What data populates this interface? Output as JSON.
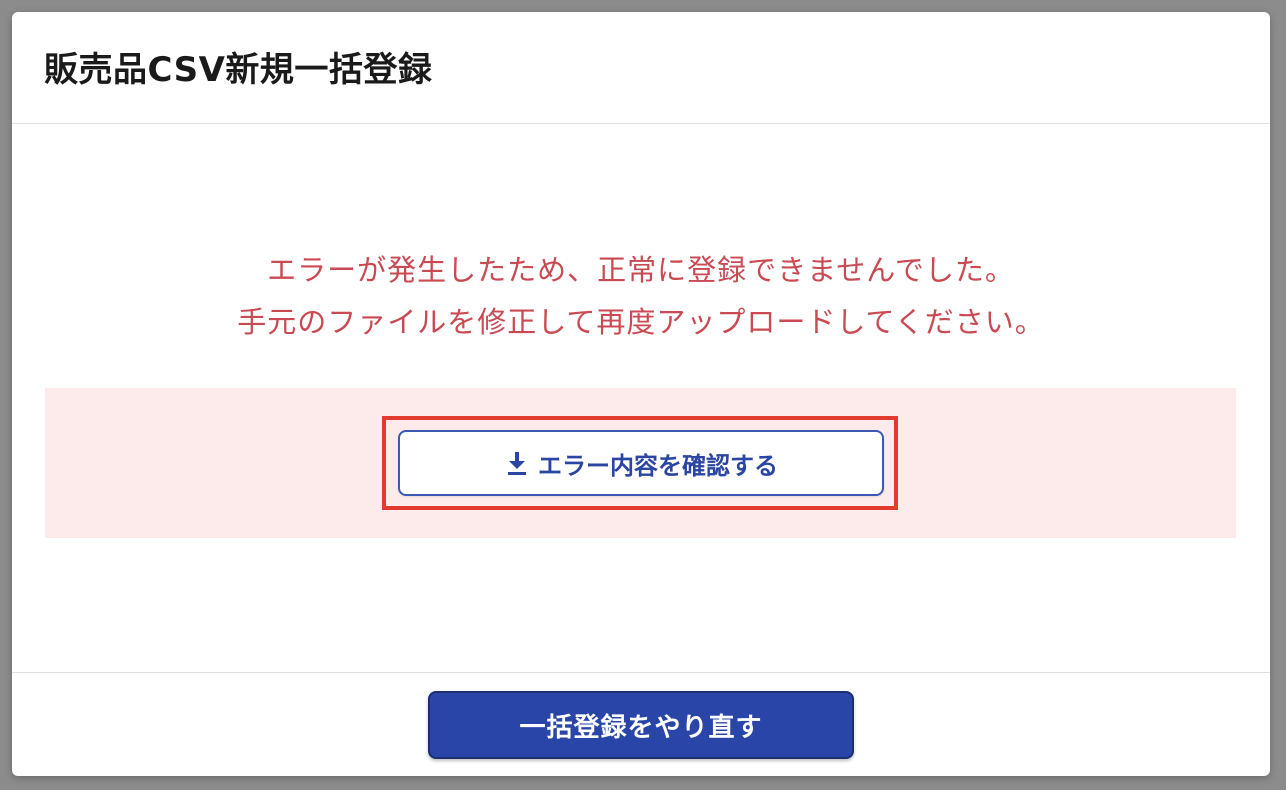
{
  "dialog": {
    "title": "販売品CSV新規一括登録"
  },
  "error": {
    "line1": "エラーが発生したため、正常に登録できませんでした。",
    "line2": "手元のファイルを修正して再度アップロードしてください。",
    "text_color": "#c94a52",
    "band_color": "#fcebea"
  },
  "error_detail_button": {
    "label": "エラー内容を確認する",
    "icon": "download-icon",
    "highlight_color": "#e23b2e"
  },
  "footer": {
    "redo_label": "一括登録をやり直す",
    "redo_color": "#2945a8"
  }
}
